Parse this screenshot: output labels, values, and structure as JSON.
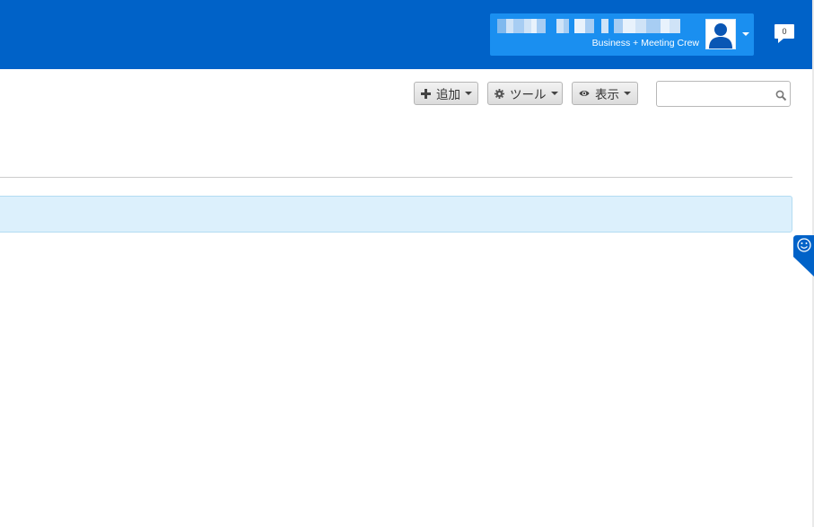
{
  "header": {
    "user_company": "Business + Meeting Crew",
    "notifications_count": "0"
  },
  "toolbar": {
    "add_label": "追加",
    "tools_label": "ツール",
    "view_label": "表示"
  },
  "search": {
    "value": "",
    "placeholder": ""
  },
  "colors": {
    "header_bg": "#0062c8",
    "user_menu_bg": "#1a8ff0",
    "info_bar_bg": "#dcf0fc",
    "feedback_tab": "#0062c8"
  },
  "icons": {
    "add": "plus-icon",
    "tools": "gear-icon",
    "view": "eye-icon",
    "search": "search-icon",
    "feedback": "smiley-icon",
    "notifications": "speech-bubble-icon",
    "avatar": "user-silhouette-icon"
  }
}
